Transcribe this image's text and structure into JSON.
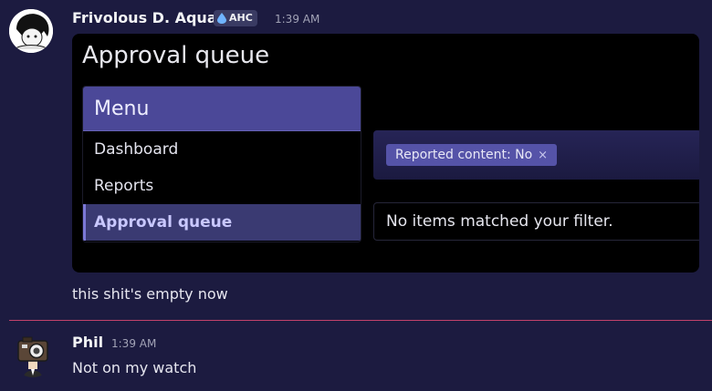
{
  "messages": [
    {
      "author": "Frivolous D. Aqua",
      "tag": "AHC",
      "tag_icon": "droplet-icon",
      "time": "1:39 AM",
      "attachment": {
        "title": "Approval queue",
        "menu": {
          "header": "Menu",
          "items": [
            "Dashboard",
            "Reports",
            "Approval queue"
          ],
          "active_index": 2
        },
        "filter_chip": "Reported content: No",
        "filter_chip_remove": "×",
        "empty_message": "No items matched your filter."
      },
      "text": "this shit's empty now"
    },
    {
      "author": "Phil",
      "time": "1:39 AM",
      "text": "Not on my watch"
    }
  ],
  "colors": {
    "background": "#1c1b40",
    "menu_header": "#4b4898",
    "chip": "#5553a8",
    "new_divider": "#c2416b"
  }
}
